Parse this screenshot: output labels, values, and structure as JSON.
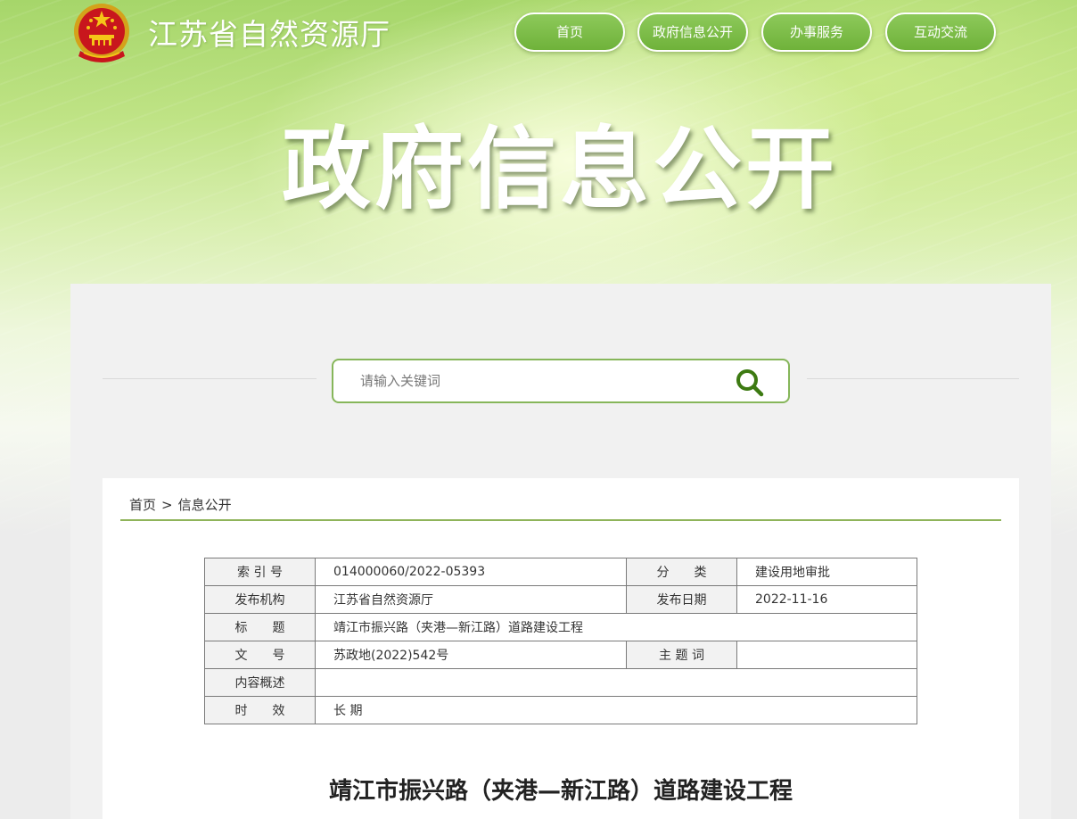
{
  "header": {
    "site_name": "江苏省自然资源厅",
    "nav": [
      "首页",
      "政府信息公开",
      "办事服务",
      "互动交流"
    ],
    "banner_title": "政府信息公开"
  },
  "search": {
    "placeholder": "请输入关键词",
    "value": ""
  },
  "breadcrumb": {
    "home": "首页",
    "separator": ">",
    "current": "信息公开"
  },
  "meta": {
    "index_label": "索 引 号",
    "index_value": "014000060/2022-05393",
    "category_label": "分　　类",
    "category_value": "建设用地审批",
    "publisher_label": "发布机构",
    "publisher_value": "江苏省自然资源厅",
    "date_label": "发布日期",
    "date_value": "2022-11-16",
    "title_label": "标　　题",
    "title_value": "靖江市振兴路（夹港—新江路）道路建设工程",
    "docno_label": "文　　号",
    "docno_value": "苏政地(2022)542号",
    "keywords_label": "主 题 词",
    "keywords_value": "",
    "summary_label": "内容概述",
    "summary_value": "",
    "validity_label": "时　　效",
    "validity_value": "长 期"
  },
  "document": {
    "title": "靖江市振兴路（夹港—新江路）道路建设工程"
  },
  "colors": {
    "accent": "#6fb23a",
    "border": "#86b65a",
    "icon": "#3d7a12"
  }
}
